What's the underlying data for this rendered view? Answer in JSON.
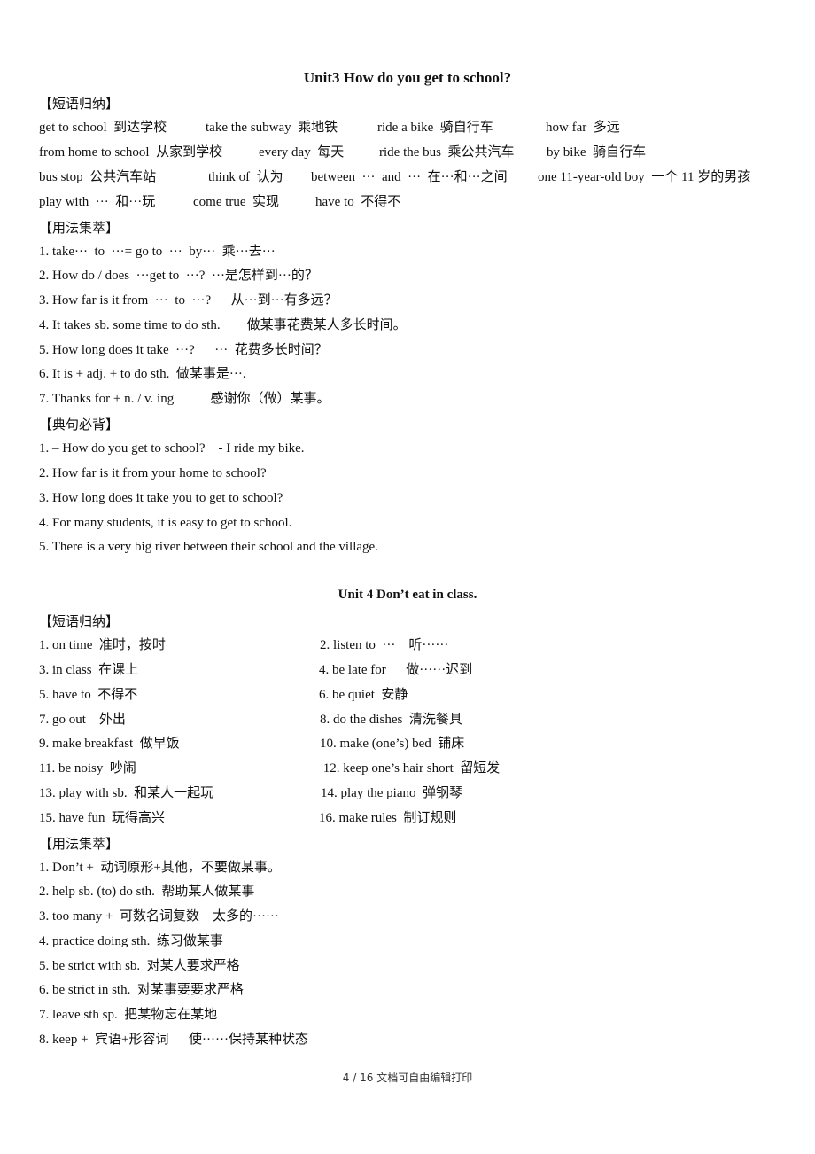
{
  "unit3": {
    "title": "Unit3 How do you get to school?",
    "phrases_heading": "【短语归纳】",
    "phrase_rows": [
      [
        "get to school  到达学校",
        "take the subway  乘地铁",
        "ride a bike  骑自行车",
        "how far  多远"
      ],
      [
        "from home to school  从家到学校",
        "every day  每天",
        "ride the bus  乘公共汽车",
        "by bike  骑自行车"
      ],
      [
        "bus stop  公共汽车站",
        "think of  认为",
        "between  ···  and  ···  在···和···之间",
        "one 11-year-old boy  一个 11 岁的男孩"
      ],
      [
        "play with  ···  和···玩",
        "come true  实现",
        "have to  不得不"
      ]
    ],
    "usage_heading": "【用法集萃】",
    "usage": [
      "1. take···  to  ···= go to  ···  by···  乘···去···",
      "2. How do / does  ···get to  ···?  ···是怎样到···的？",
      "3. How far is it from  ···  to  ···?      从···到···有多远？",
      "4. It takes sb. some time to do sth.        做某事花费某人多长时间。",
      "5. How long does it take  ···?      ···  花费多长时间？",
      "6. It is + adj. + to do sth.  做某事是···.",
      "7. Thanks for + n. / v. ing           感谢你（做）某事。"
    ],
    "sentences_heading": "【典句必背】",
    "sentences": [
      "1. – How do you get to school?    - I ride my bike.",
      "2. How far is it from your home to school?",
      "3. How long does it take you to get to school?",
      "4. For many students, it is easy to get to school.",
      "5. There is a very big river between their school and the village."
    ]
  },
  "unit4": {
    "title": "Unit 4  Don’t eat in class.",
    "phrases_heading": "【短语归纳】",
    "phrases_left": [
      "1. on time  准时，按时",
      "3. in class  在课上",
      "5. have to  不得不",
      "7. go out    外出",
      "9. make breakfast  做早饭",
      "11. be noisy  吵闹",
      "13. play with sb.  和某人一起玩",
      "15. have fun  玩得高兴"
    ],
    "phrases_right": [
      "2. listen to  ···    听······",
      "4. be late for      做······迟到",
      "6. be quiet  安静",
      "8. do the dishes  清洗餐具",
      "10. make (one’s) bed  铺床",
      " 12. keep one’s hair short  留短发",
      "14. play the piano  弹钢琴",
      "16. make rules  制订规则"
    ],
    "usage_heading": "【用法集萃】",
    "usage": [
      "1. Don’t +  动词原形+其他，不要做某事。",
      "2. help sb. (to) do sth.  帮助某人做某事",
      "3. too many +  可数名词复数    太多的······",
      "4. practice doing sth.  练习做某事",
      "5. be strict with sb.  对某人要求严格",
      "6. be strict in sth.  对某事要要求严格",
      "7. leave sth sp.  把某物忘在某地",
      "8. keep +  宾语+形容词      使······保持某种状态"
    ]
  },
  "footer": "4  /  16 文档可自由编辑打印"
}
